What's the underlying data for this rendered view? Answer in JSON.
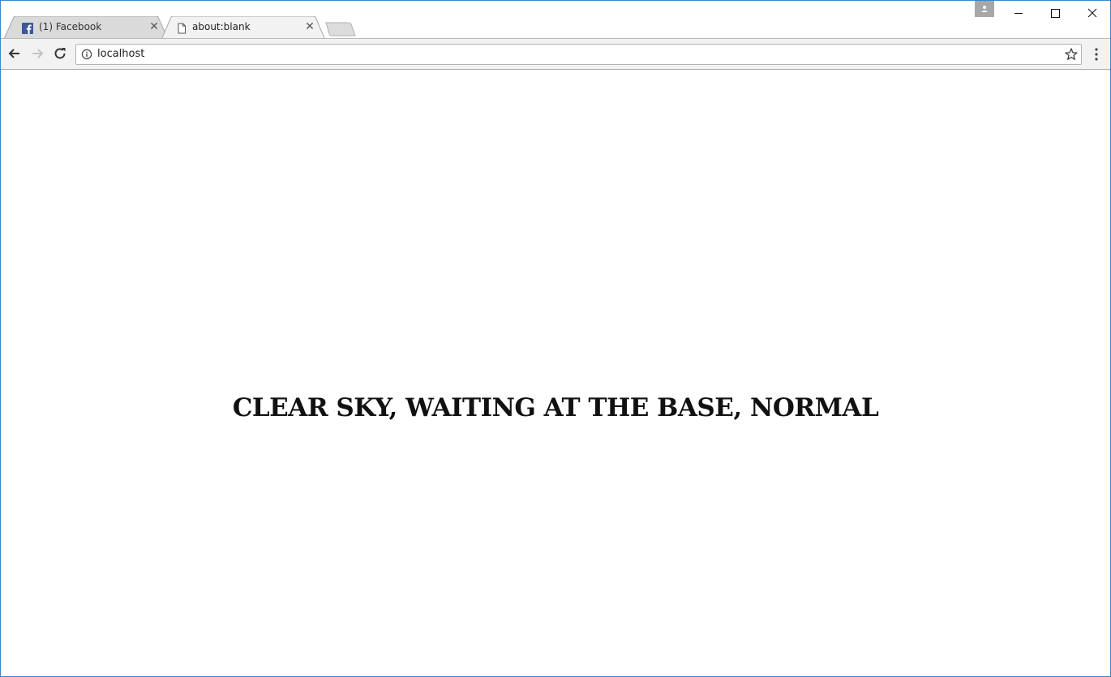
{
  "browser": {
    "tabs": [
      {
        "title": "(1) Facebook",
        "favicon": "facebook-icon",
        "active": false
      },
      {
        "title": "about:blank",
        "favicon": "page-icon",
        "active": true
      }
    ],
    "close_glyph": "✕",
    "url": "localhost",
    "icons": {
      "back": "arrow-left-icon",
      "forward": "arrow-right-icon",
      "reload": "reload-icon",
      "info": "info-icon",
      "bookmark": "star-icon",
      "menu": "kebab-menu-icon",
      "profile": "person-icon"
    },
    "colors": {
      "facebook_blue": "#3b5998",
      "window_border": "#3a86c8",
      "toolbar_bg": "#f2f2f2"
    }
  },
  "page": {
    "message": "CLEAR SKY, WAITING AT THE BASE, NORMAL"
  }
}
